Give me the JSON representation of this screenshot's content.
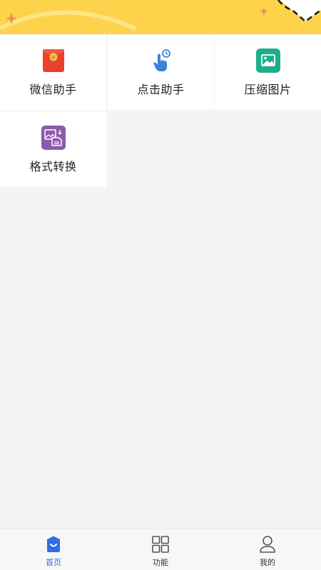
{
  "colors": {
    "banner": "#fcd34a",
    "accent": "#2f6fe4",
    "tile_bg": "#ffffff",
    "page_bg": "#f3f4f6"
  },
  "features": [
    {
      "label": "微信助手",
      "icon": "red-envelope-icon"
    },
    {
      "label": "点击助手",
      "icon": "tap-hand-icon"
    },
    {
      "label": "压缩图片",
      "icon": "image-icon"
    },
    {
      "label": "格式转换",
      "icon": "convert-file-icon"
    }
  ],
  "bottom_nav": {
    "items": [
      {
        "label": "首页",
        "icon": "home-bag-icon",
        "active": true
      },
      {
        "label": "功能",
        "icon": "grid-icon",
        "active": false
      },
      {
        "label": "我的",
        "icon": "user-icon",
        "active": false
      }
    ]
  }
}
